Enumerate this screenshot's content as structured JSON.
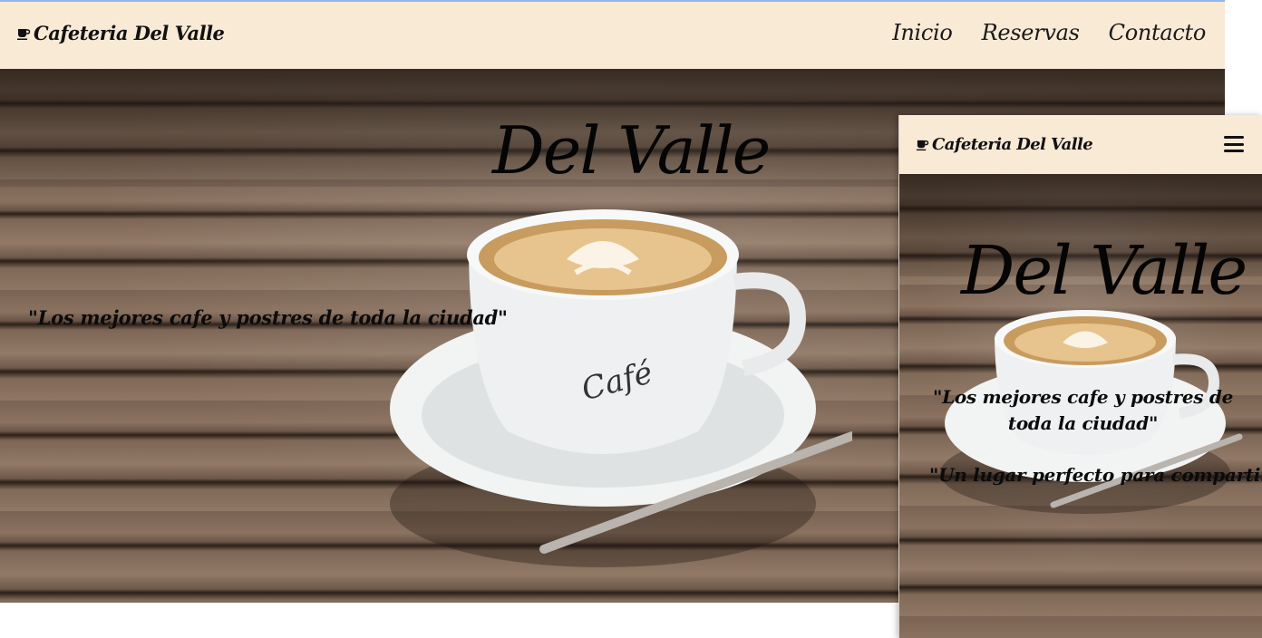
{
  "desktop": {
    "nav": {
      "brand": "Cafeteria Del Valle",
      "brand_icon": "coffee-cup-icon",
      "links": [
        "Inicio",
        "Reservas",
        "Contacto"
      ]
    },
    "hero": {
      "title": "Del Valle",
      "quote": "\"Los mejores cafe y postres de toda la ciudad\"",
      "cup_label": "Café"
    }
  },
  "mobile": {
    "nav": {
      "brand": "Cafeteria Del Valle",
      "brand_icon": "coffee-cup-icon",
      "menu_icon": "hamburger-menu-icon"
    },
    "hero": {
      "title": "Del Valle",
      "quote": "\"Los mejores cafe y postres de toda la ciudad\"",
      "quote2": "\"Un lugar perfecto para compartir\""
    }
  },
  "colors": {
    "nav_bg": "#f9ead6",
    "text": "#111111",
    "wood": "#7d6655"
  }
}
